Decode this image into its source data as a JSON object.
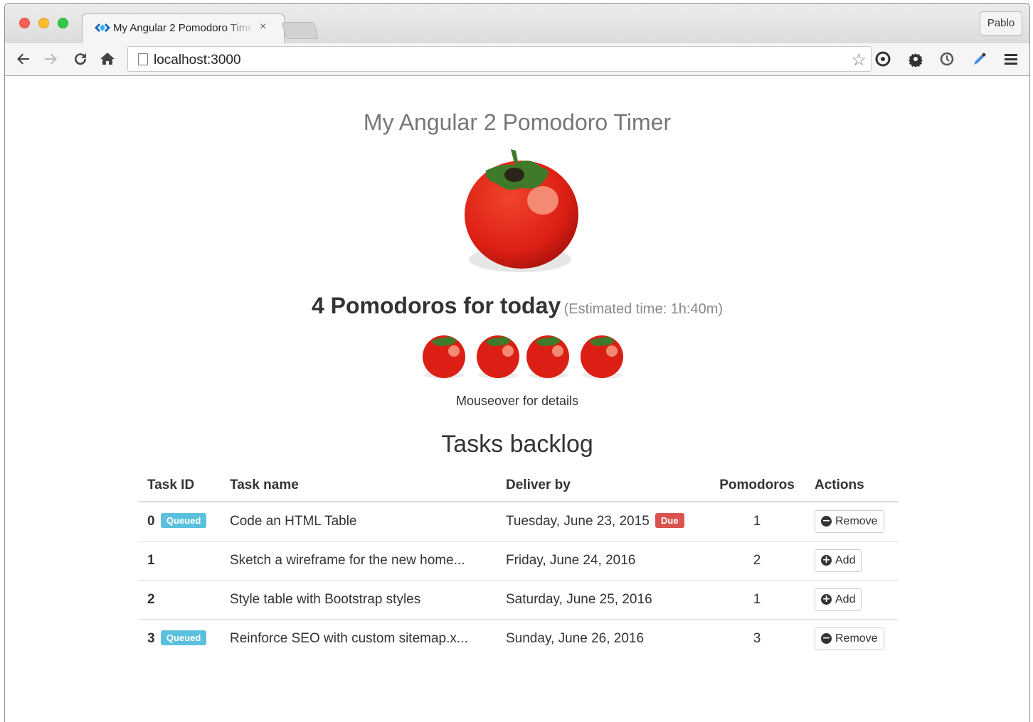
{
  "browser": {
    "tab_title": "My Angular 2 Pomodoro Timer",
    "tab_close": "×",
    "profile": "Pablo",
    "url": "localhost:3000",
    "nav_icons": [
      "back-arrow-icon",
      "forward-arrow-icon",
      "reload-icon",
      "home-icon"
    ],
    "extension_icons": [
      "star-icon",
      "record-icon",
      "gear-icon",
      "clock-extension-icon",
      "eyedropper-icon",
      "menu-icon"
    ]
  },
  "page": {
    "title": "My Angular 2 Pomodoro Timer",
    "today_main": "4 Pomodoros for today",
    "today_estimate": "(Estimated time: 1h:40m)",
    "pomodoro_count": 4,
    "mouseover": "Mouseover for details",
    "backlog_title": "Tasks backlog"
  },
  "table": {
    "headers": [
      "Task ID",
      "Task name",
      "Deliver by",
      "Pomodoros",
      "Actions"
    ],
    "rows": [
      {
        "id": "0",
        "badge": "Queued",
        "name": "Code an HTML Table",
        "deliver": "Tuesday, June 23, 2015",
        "due": "Due",
        "pomodoros": "1",
        "action": "Remove",
        "action_glyph": "−"
      },
      {
        "id": "1",
        "badge": "",
        "name": "Sketch a wireframe for the new home...",
        "deliver": "Friday, June 24, 2016",
        "due": "",
        "pomodoros": "2",
        "action": "Add",
        "action_glyph": "+"
      },
      {
        "id": "2",
        "badge": "",
        "name": "Style table with Bootstrap styles",
        "deliver": "Saturday, June 25, 2016",
        "due": "",
        "pomodoros": "1",
        "action": "Add",
        "action_glyph": "+"
      },
      {
        "id": "3",
        "badge": "Queued",
        "name": "Reinforce SEO with custom sitemap.x...",
        "deliver": "Sunday, June 26, 2016",
        "due": "",
        "pomodoros": "3",
        "action": "Remove",
        "action_glyph": "−"
      }
    ]
  },
  "colors": {
    "queued_badge": "#5bc0de",
    "due_badge": "#d9534f",
    "tomato_red": "#e0231a",
    "leaf_green": "#3f7a2a"
  }
}
